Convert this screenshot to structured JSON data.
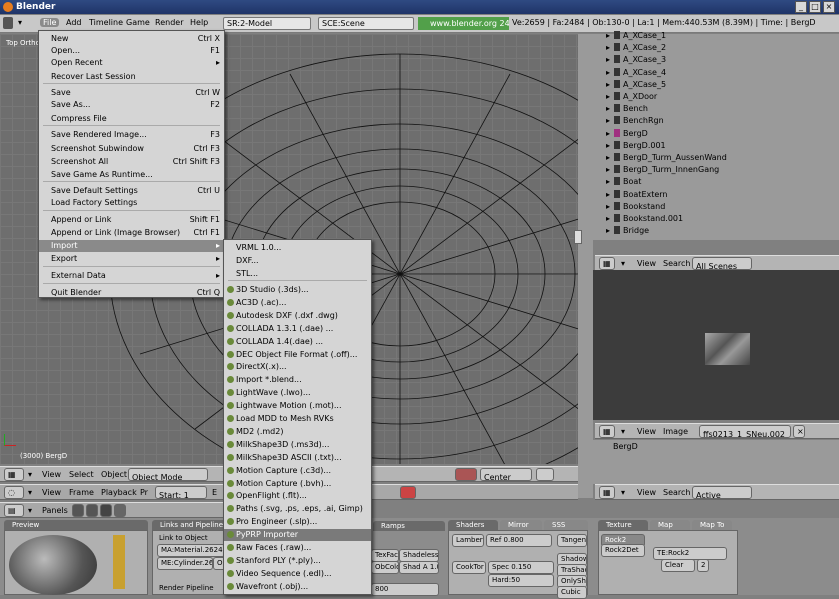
{
  "window": {
    "title": "Blender"
  },
  "menubar": {
    "items": [
      "File",
      "Add",
      "Timeline",
      "Game",
      "Render",
      "Help"
    ],
    "screen": "SR:2-Model",
    "scene": "SCE:Scene",
    "url": "www.blender.org 249.2",
    "stats": "Ve:2659 | Fa:2484 | Ob:130-0 | La:1 | Mem:440.53M (8.39M) | Time: | BergD"
  },
  "viewport": {
    "label": "Top Ortho",
    "object": "(3000) BergD"
  },
  "file_menu": [
    {
      "label": "New",
      "shortcut": "Ctrl X"
    },
    {
      "label": "Open...",
      "shortcut": "F1"
    },
    {
      "label": "Open Recent",
      "shortcut": "▸"
    },
    {
      "label": "Recover Last Session",
      "shortcut": ""
    },
    {
      "label": "Save",
      "shortcut": "Ctrl W"
    },
    {
      "label": "Save As...",
      "shortcut": "F2"
    },
    {
      "label": "Compress File",
      "shortcut": ""
    },
    {
      "label": "Save Rendered Image...",
      "shortcut": "F3"
    },
    {
      "label": "Screenshot Subwindow",
      "shortcut": "Ctrl F3"
    },
    {
      "label": "Screenshot All",
      "shortcut": "Ctrl Shift F3"
    },
    {
      "label": "Save Game As Runtime...",
      "shortcut": ""
    },
    {
      "label": "Save Default Settings",
      "shortcut": "Ctrl U"
    },
    {
      "label": "Load Factory Settings",
      "shortcut": ""
    },
    {
      "label": "Append or Link",
      "shortcut": "Shift F1"
    },
    {
      "label": "Append or Link (Image Browser)",
      "shortcut": "Ctrl F1"
    },
    {
      "label": "Import",
      "shortcut": "▸"
    },
    {
      "label": "Export",
      "shortcut": "▸"
    },
    {
      "label": "External Data",
      "shortcut": "▸"
    },
    {
      "label": "Quit Blender",
      "shortcut": "Ctrl Q"
    }
  ],
  "import_menu": [
    "VRML 1.0...",
    "DXF...",
    "STL...",
    "3D Studio (.3ds)...",
    "AC3D (.ac)...",
    "Autodesk DXF (.dxf .dwg)",
    "COLLADA 1.3.1 (.dae) ...",
    "COLLADA 1.4(.dae) ...",
    "DEC Object File Format (.off)...",
    "DirectX(.x)...",
    "Import *.blend...",
    "LightWave (.lwo)...",
    "Lightwave Motion (.mot)...",
    "Load MDD to Mesh RVKs",
    "MD2 (.md2)",
    "MilkShape3D (.ms3d)...",
    "MilkShape3D ASCII (.txt)...",
    "Motion Capture (.c3d)...",
    "Motion Capture (.bvh)...",
    "OpenFlight (.flt)...",
    "Paths (.svg, .ps, .eps, .ai, Gimp)",
    "Pro Engineer (.slp)...",
    "PyPRP Importer",
    "Raw Faces (.raw)...",
    "Stanford PLY (*.ply)...",
    "Video Sequence (.edl)...",
    "Wavefront (.obj)..."
  ],
  "outliner": {
    "items": [
      "A_XCase_1",
      "A_XCase_2",
      "A_XCase_3",
      "A_XCase_4",
      "A_XCase_5",
      "A_XDoor",
      "Bench",
      "BenchRgn",
      "BergD",
      "BergD.001",
      "BergD_Turm_AussenWand",
      "BergD_Turm_InnenGang",
      "Boat",
      "BoatExtern",
      "Bookstand",
      "Bookstand.001",
      "Bridge"
    ],
    "header": {
      "view": "View",
      "search": "Search",
      "scope": "All Scenes"
    }
  },
  "image_header": {
    "view": "View",
    "image": "Image",
    "file": "ffs0213_1_SNeu.002"
  },
  "lower_outliner": {
    "item": "BergD",
    "view": "View",
    "search": "Search",
    "scope": "Active"
  },
  "view3d_header": {
    "view": "View",
    "select": "Select",
    "object": "Object",
    "mode": "Object Mode",
    "pivot": "Center"
  },
  "timeline_header": {
    "view": "View",
    "frame": "Frame",
    "playback": "Playback",
    "pr": "Pr",
    "start": "Start: 1",
    "e": "E"
  },
  "buttons_header": {
    "panels": "Panels"
  },
  "props": {
    "preview": "Preview",
    "links": "Links and Pipeline",
    "link_to_object": "Link to Object",
    "material": "MA:Material.2624",
    "mesh": "ME:Cylinder.269",
    "ob": "OB",
    "render_pipeline": "Render Pipeline",
    "ramps": "Ramps",
    "shaders": "Shaders",
    "mirror": "Mirror Tran",
    "sss": "SSS",
    "lambert": "Lambert",
    "ref": "Ref  0.800",
    "tangent": "Tangent",
    "texface": "TexFace",
    "shadeless": "Shadeless",
    "obcolor": "ObColor",
    "shad": "Shad A 1.00",
    "cooktor": "CookTor",
    "spec": "Spec 0.150",
    "hard": "Hard:50",
    "shadow": "Shadow",
    "trashadow": "TraShado",
    "onlyshad": "OnlyShad",
    "cubic": "Cubic",
    "val800": "800",
    "texture": "Texture",
    "map_input": "Map Input",
    "map_to": "Map To",
    "tex1": "Rock2",
    "tex2": "Rock2Det",
    "te": "TE:Rock2",
    "clear": "Clear",
    "num": "2"
  }
}
